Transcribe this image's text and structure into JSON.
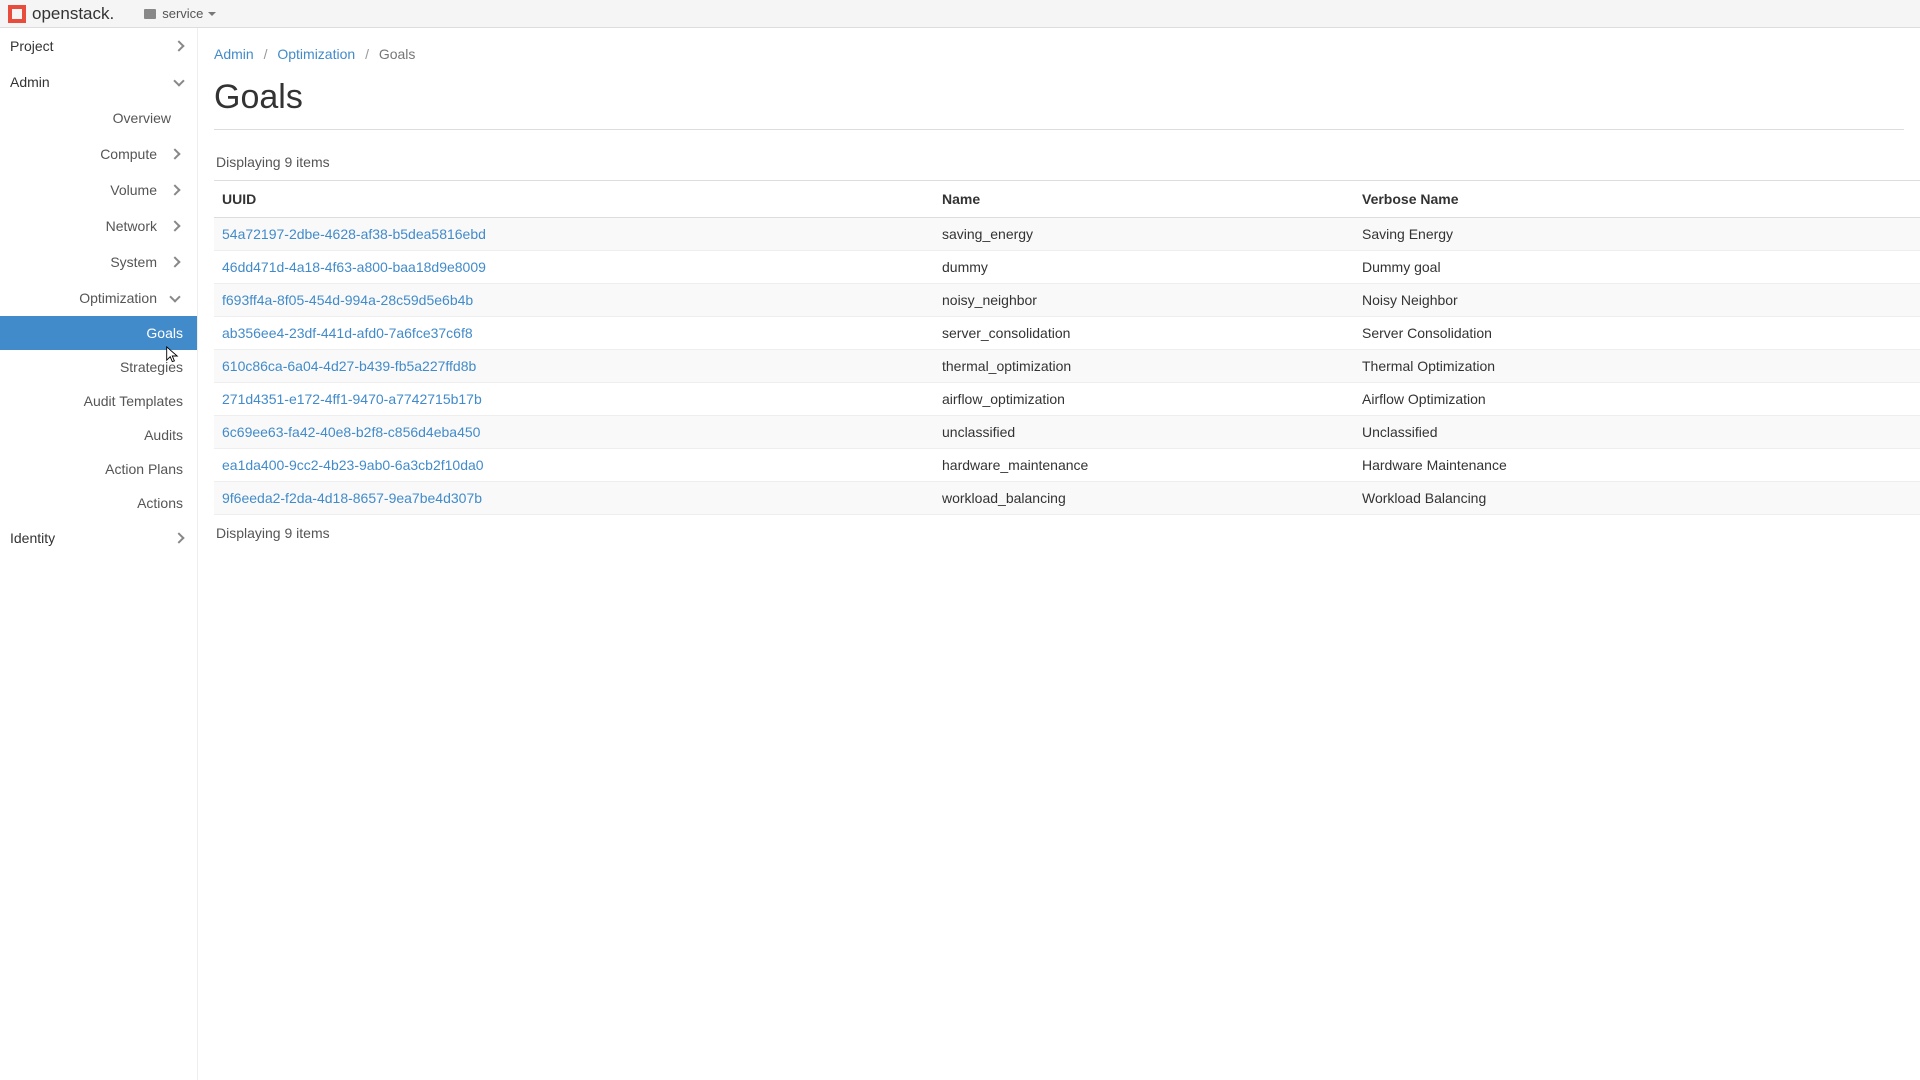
{
  "brand": "openstack.",
  "project_selector": {
    "label": "service"
  },
  "sidebar": {
    "project": "Project",
    "admin": "Admin",
    "admin_children": {
      "overview": "Overview",
      "compute": "Compute",
      "volume": "Volume",
      "network": "Network",
      "system": "System",
      "optimization": "Optimization",
      "opt_children": {
        "goals": "Goals",
        "strategies": "Strategies",
        "audit_templates": "Audit Templates",
        "audits": "Audits",
        "action_plans": "Action Plans",
        "actions": "Actions"
      }
    },
    "identity": "Identity"
  },
  "breadcrumb": {
    "admin": "Admin",
    "optimization": "Optimization",
    "goals": "Goals"
  },
  "page_title": "Goals",
  "count_text_top": "Displaying 9 items",
  "count_text_bottom": "Displaying 9 items",
  "table": {
    "headers": {
      "uuid": "UUID",
      "name": "Name",
      "verbose": "Verbose Name"
    },
    "rows": [
      {
        "uuid": "54a72197-2dbe-4628-af38-b5dea5816ebd",
        "name": "saving_energy",
        "verbose": "Saving Energy"
      },
      {
        "uuid": "46dd471d-4a18-4f63-a800-baa18d9e8009",
        "name": "dummy",
        "verbose": "Dummy goal"
      },
      {
        "uuid": "f693ff4a-8f05-454d-994a-28c59d5e6b4b",
        "name": "noisy_neighbor",
        "verbose": "Noisy Neighbor"
      },
      {
        "uuid": "ab356ee4-23df-441d-afd0-7a6fce37c6f8",
        "name": "server_consolidation",
        "verbose": "Server Consolidation"
      },
      {
        "uuid": "610c86ca-6a04-4d27-b439-fb5a227ffd8b",
        "name": "thermal_optimization",
        "verbose": "Thermal Optimization"
      },
      {
        "uuid": "271d4351-e172-4ff1-9470-a7742715b17b",
        "name": "airflow_optimization",
        "verbose": "Airflow Optimization"
      },
      {
        "uuid": "6c69ee63-fa42-40e8-b2f8-c856d4eba450",
        "name": "unclassified",
        "verbose": "Unclassified"
      },
      {
        "uuid": "ea1da400-9cc2-4b23-9ab0-6a3cb2f10da0",
        "name": "hardware_maintenance",
        "verbose": "Hardware Maintenance"
      },
      {
        "uuid": "9f6eeda2-f2da-4d18-8657-9ea7be4d307b",
        "name": "workload_balancing",
        "verbose": "Workload Balancing"
      }
    ]
  }
}
